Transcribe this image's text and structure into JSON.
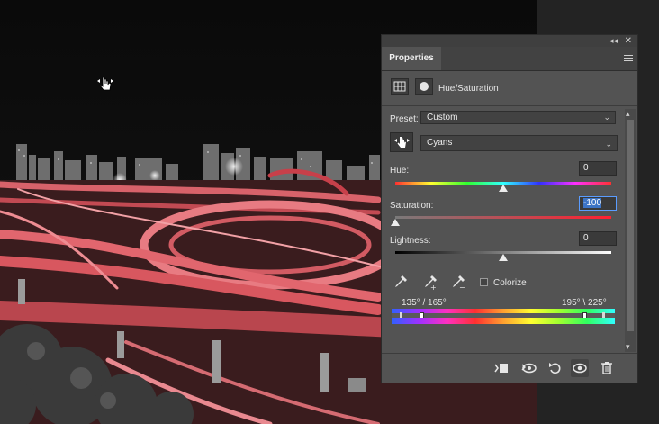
{
  "panel": {
    "tab": "Properties",
    "adjustment_title": "Hue/Saturation"
  },
  "preset": {
    "label": "Preset:",
    "value": "Custom"
  },
  "channel": {
    "value": "Cyans"
  },
  "hue": {
    "label": "Hue:",
    "value": "0",
    "level": 0.5
  },
  "saturation": {
    "label": "Saturation:",
    "value": "-100",
    "level": 0.0
  },
  "lightness": {
    "label": "Lightness:",
    "value": "0",
    "level": 0.5
  },
  "colorize": {
    "label": "Colorize",
    "checked": false
  },
  "range": {
    "left_values": "135° / 165°",
    "right_values": "195° \\ 225°"
  },
  "colors": {
    "panel_bg": "#535353",
    "active_field": "#3d74c5",
    "photo_tint": "#e8545c"
  },
  "icons": {
    "collapse": "double-chevron-left-icon",
    "close": "close-icon",
    "menu": "panel-menu-icon",
    "adjustment": "hue-saturation-icon",
    "mask": "layer-mask-icon",
    "hand": "targeted-adjustment-hand-icon",
    "eyedroppers": [
      "eyedropper-icon",
      "eyedropper-plus-icon",
      "eyedropper-minus-icon"
    ],
    "footer": [
      "clip-to-layer-icon",
      "view-previous-icon",
      "reset-icon",
      "visibility-eye-icon",
      "trash-icon"
    ]
  }
}
